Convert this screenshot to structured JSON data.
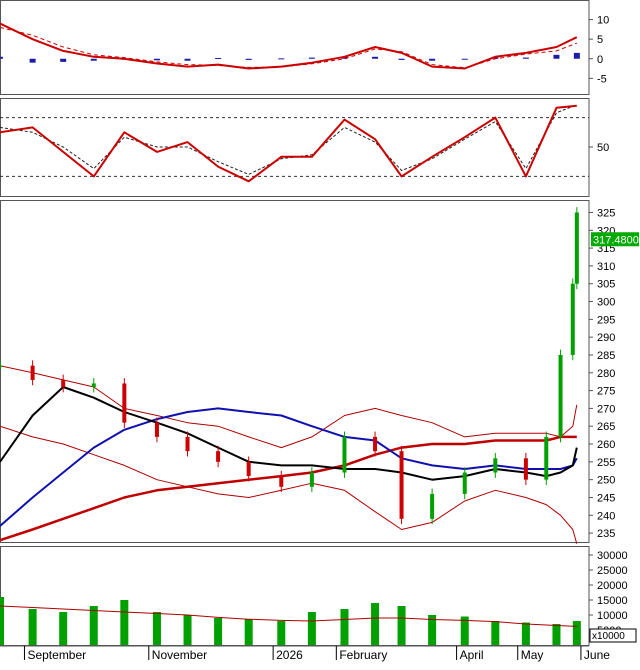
{
  "colors": {
    "background": "#ffffff",
    "frame": "#555555",
    "up_candle": "#00a000",
    "down_candle": "#cc0000",
    "macd_line": "#cc0000",
    "signal_line": "#cc0000",
    "hist_pos": "#1c1caa",
    "stoch_k": "#cc0000",
    "stoch_d": "#222222",
    "bb": "#b00000",
    "ma_short": "#000000",
    "ma_mid": "#1010b0",
    "ma_long": "#c00000",
    "volume": "#00a000",
    "vol_ma": "#b00000",
    "price_tag_bg": "#00aa00",
    "price_tag_text": "#ffffff"
  },
  "chart_data": [
    {
      "type": "line",
      "panel": "macd",
      "y_ticks": [
        "10",
        "5",
        "0",
        "-5"
      ],
      "ylim": [
        -9,
        15
      ],
      "x_dates": [
        "2025-08-20",
        "2025-09-05",
        "2025-09-20",
        "2025-10-05",
        "2025-10-20",
        "2025-11-05",
        "2025-11-20",
        "2025-12-05",
        "2025-12-20",
        "2026-01-05",
        "2026-01-20",
        "2026-02-05",
        "2026-02-20",
        "2026-03-05",
        "2026-03-20",
        "2026-04-05",
        "2026-04-20",
        "2026-05-05",
        "2026-05-20",
        "2026-05-30"
      ],
      "series": [
        {
          "values": [
            9,
            5,
            2,
            0.5,
            0,
            -1.2,
            -2,
            -1.5,
            -2.5,
            -2,
            -1,
            0.5,
            3,
            1.5,
            -2,
            -2.5,
            0.5,
            1.5,
            3,
            5.5
          ]
        },
        {
          "values": [
            8,
            6,
            3,
            1,
            0.3,
            -0.8,
            -1.5,
            -1.7,
            -2.2,
            -2.1,
            -1.3,
            0,
            2.5,
            1.8,
            -1.5,
            -2.3,
            0,
            1.2,
            2,
            4
          ]
        }
      ],
      "histogram": [
        0.5,
        -1,
        -0.8,
        -0.5,
        -0.2,
        -0.4,
        -0.5,
        0.2,
        -0.3,
        0.1,
        0.3,
        0.5,
        0.5,
        -0.3,
        -0.5,
        -0.2,
        0.5,
        0.3,
        1,
        1.5
      ]
    },
    {
      "type": "line",
      "panel": "stochastic",
      "y_ticks": [
        "50"
      ],
      "ylim": [
        0,
        100
      ],
      "x_dates": [
        "2025-08-20",
        "2025-09-05",
        "2025-09-20",
        "2025-10-05",
        "2025-10-20",
        "2025-11-05",
        "2025-11-20",
        "2025-12-05",
        "2025-12-20",
        "2026-01-05",
        "2026-01-20",
        "2026-02-05",
        "2026-02-20",
        "2026-03-05",
        "2026-03-20",
        "2026-04-05",
        "2026-04-20",
        "2026-05-05",
        "2026-05-20",
        "2026-05-30"
      ],
      "series": [
        {
          "values": [
            65,
            70,
            45,
            20,
            65,
            45,
            55,
            30,
            15,
            40,
            40,
            78,
            58,
            20,
            40,
            60,
            80,
            20,
            90,
            92
          ]
        },
        {
          "values": [
            70,
            65,
            50,
            28,
            60,
            50,
            50,
            35,
            22,
            38,
            42,
            70,
            55,
            26,
            38,
            58,
            76,
            28,
            85,
            93
          ]
        }
      ],
      "reference_lines": [
        80,
        20
      ]
    },
    {
      "type": "candlestick",
      "panel": "price",
      "y_ticks": [
        "325",
        "320",
        "315",
        "310",
        "305",
        "300",
        "295",
        "290",
        "285",
        "280",
        "275",
        "270",
        "265",
        "260",
        "255",
        "250",
        "245",
        "240",
        "235"
      ],
      "ylim": [
        232.5,
        328.5
      ],
      "last_price_label": "317.4800",
      "x_dates": [
        "2025-08-20",
        "2025-09-05",
        "2025-09-20",
        "2025-10-05",
        "2025-10-20",
        "2025-11-05",
        "2025-11-20",
        "2025-12-05",
        "2025-12-20",
        "2026-01-05",
        "2026-01-20",
        "2026-02-05",
        "2026-02-20",
        "2026-03-05",
        "2026-03-20",
        "2026-04-05",
        "2026-04-20",
        "2026-05-05",
        "2026-05-15",
        "2026-05-22",
        "2026-05-28",
        "2026-05-30"
      ],
      "close": [
        282,
        278,
        276,
        277,
        266,
        262,
        258,
        255,
        251,
        248,
        252,
        262,
        258,
        239,
        246,
        252,
        256,
        250,
        262,
        285,
        305,
        325
      ],
      "bollinger_upper": [
        282,
        280,
        278,
        276,
        270,
        268,
        266,
        265,
        262,
        259,
        262,
        268,
        270,
        268,
        266,
        262,
        263,
        263,
        263,
        262,
        265,
        271
      ],
      "bollinger_lower": [
        265,
        262,
        260,
        257,
        254,
        250,
        248,
        246,
        245,
        247,
        249,
        247,
        241,
        236,
        238,
        244,
        247,
        245,
        243,
        240,
        236,
        232
      ],
      "ma_short": [
        255,
        268,
        276,
        273,
        269,
        266,
        263,
        259,
        255,
        254,
        254,
        253,
        253,
        252,
        250,
        251,
        253,
        252,
        251,
        252,
        254,
        259
      ],
      "ma_mid": [
        237,
        245,
        252,
        259,
        264,
        267,
        269,
        270,
        269,
        268,
        265,
        262,
        261,
        256,
        254,
        253,
        254,
        253,
        253,
        253,
        254,
        256
      ],
      "ma_long": [
        233,
        236,
        239,
        242,
        245,
        247,
        248,
        249,
        250,
        251,
        252,
        254,
        257,
        259,
        260,
        260,
        261,
        261,
        261,
        262,
        262,
        262
      ]
    },
    {
      "type": "bar",
      "panel": "volume",
      "y_ticks": [
        "30000",
        "25000",
        "20000",
        "15000",
        "10000",
        "5000"
      ],
      "unit_label": "x10000",
      "ylim": [
        0,
        33000
      ],
      "x_dates": [
        "2025-08-20",
        "2025-09-05",
        "2025-09-20",
        "2025-10-05",
        "2025-10-20",
        "2025-11-05",
        "2025-11-20",
        "2025-12-05",
        "2025-12-20",
        "2026-01-05",
        "2026-01-20",
        "2026-02-05",
        "2026-02-20",
        "2026-03-05",
        "2026-03-20",
        "2026-04-05",
        "2026-04-20",
        "2026-05-05",
        "2026-05-20",
        "2026-05-30"
      ],
      "values": [
        16000,
        12000,
        11000,
        13000,
        15000,
        11000,
        10000,
        9000,
        8500,
        8000,
        11000,
        12000,
        14000,
        13000,
        10000,
        9500,
        8000,
        7500,
        7000,
        8000
      ],
      "moving_average": [
        13000,
        12500,
        12000,
        11500,
        11000,
        10500,
        10000,
        9200,
        8600,
        8200,
        8000,
        8500,
        9000,
        9000,
        8500,
        8200,
        7800,
        7000,
        6500,
        6200
      ]
    }
  ],
  "x_axis": {
    "labels": [
      "September",
      "November",
      "2026",
      "February",
      "April",
      "May",
      "June"
    ],
    "label_dates": [
      "2025-09-01",
      "2025-11-01",
      "2026-01-01",
      "2026-02-01",
      "2026-04-01",
      "2026-05-01",
      "2026-06-01"
    ]
  }
}
